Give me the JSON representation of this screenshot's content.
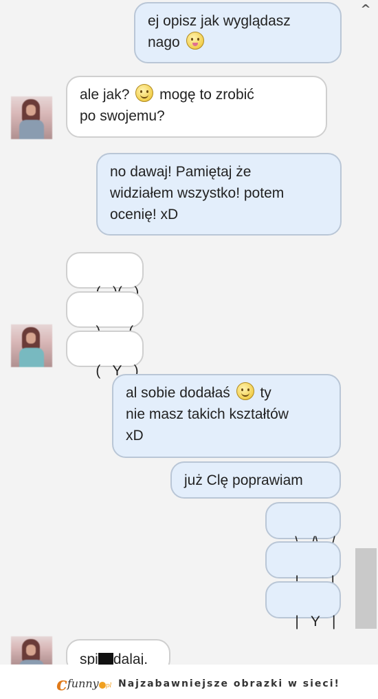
{
  "messages": [
    {
      "id": "m1",
      "dir": "out",
      "line1": "ej opisz jak wyglądasz",
      "line2": "nago"
    },
    {
      "id": "m2",
      "dir": "in",
      "line1a": "ale jak?",
      "line1b": "mogę to zrobić",
      "line2": "po swojemu?"
    },
    {
      "id": "m3",
      "dir": "out",
      "line1": "no dawaj! Pamiętaj że",
      "line2": "widziałem wszystko! potem",
      "line3": "ocenię! xD"
    },
    {
      "id": "m4",
      "dir": "in",
      "text": "( . )( . )"
    },
    {
      "id": "m5",
      "dir": "in",
      "text": ")       ("
    },
    {
      "id": "m6",
      "dir": "in",
      "text": "(   Y   )"
    },
    {
      "id": "m7",
      "dir": "out",
      "line1a": "al sobie dodałaś",
      "line1b": "ty",
      "line2": "nie masz takich kształtów",
      "line3": "xD"
    },
    {
      "id": "m8",
      "dir": "out",
      "text": "już Clę poprawiam"
    },
    {
      "id": "m9",
      "dir": "out",
      "text": "\\ . /\\ . /"
    },
    {
      "id": "m10",
      "dir": "out",
      "text": "|        |"
    },
    {
      "id": "m11",
      "dir": "out",
      "text": "|   Y   |"
    },
    {
      "id": "m12",
      "dir": "in",
      "before": "spi",
      "after": "dalaj."
    }
  ],
  "icons": {
    "scroll_up": "chevron-up-icon",
    "emoji_tongue": "tongue-out-emoji-icon",
    "emoji_smile": "smile-emoji-icon"
  },
  "footer": {
    "logo_text": "funny",
    "logo_suffix": "pl",
    "slogan": "Najzabawniejsze obrazki w sieci!"
  },
  "colors": {
    "outgoing_bubble": "#e3eefb",
    "incoming_bubble": "#ffffff",
    "logo_accent": "#e07a1a"
  }
}
